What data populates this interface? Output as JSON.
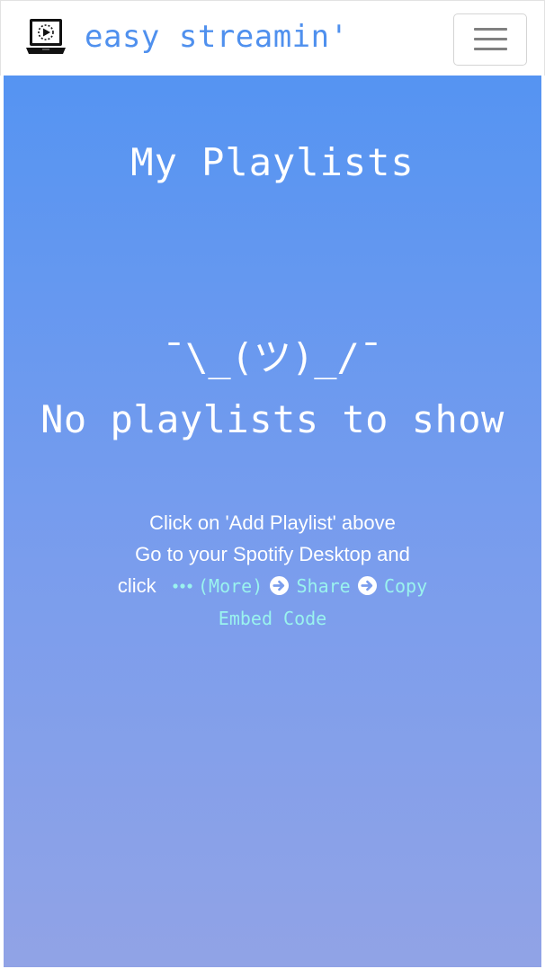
{
  "app": {
    "brand_name": "easy streamin'",
    "logo_icon": "laptop-play-icon",
    "menu_icon": "hamburger-menu-icon"
  },
  "page": {
    "title": "My Playlists",
    "shrug": "¯\\_(ツ)_/¯",
    "empty_message": "No playlists to show"
  },
  "instructions": {
    "line1": "Click on 'Add Playlist' above",
    "line2": "Go to your Spotify Desktop and",
    "line3_prefix": "click",
    "more_label": "(More)",
    "share_label": "Share",
    "copy_label": "Copy",
    "embed_label": "Embed Code",
    "dots_icon": "more-dots-icon",
    "arrow_icon": "arrow-right-circle-icon"
  },
  "colors": {
    "brand": "#4f90ee",
    "gradient_top": "#5594f2",
    "gradient_bottom": "#91a3e6",
    "code_text": "#9af3ee",
    "text": "#ffffff"
  }
}
